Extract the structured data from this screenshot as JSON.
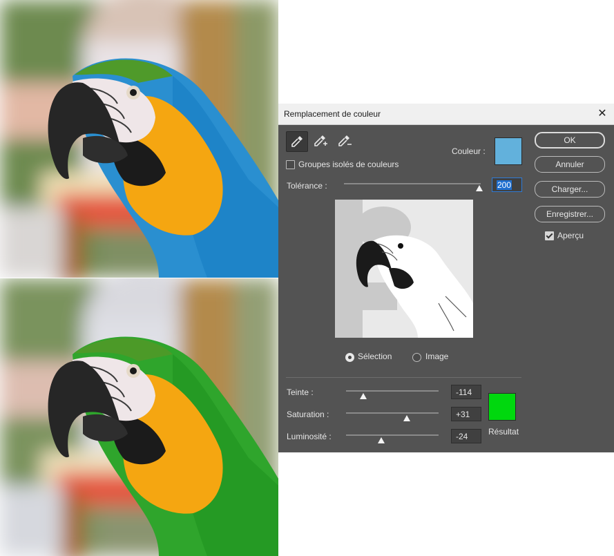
{
  "dialog": {
    "title": "Remplacement de couleur",
    "tools": [
      {
        "icon": "eyedropper-icon",
        "active": true
      },
      {
        "icon": "eyedropper-plus-icon",
        "active": false
      },
      {
        "icon": "eyedropper-minus-icon",
        "active": false
      }
    ],
    "localized_color_clusters_label": "Groupes isolés de couleurs",
    "localized_color_clusters_checked": false,
    "color_label": "Couleur :",
    "color_swatch": "#62b1dc",
    "fuzziness_label": "Tolérance :",
    "fuzziness_value": "200",
    "radio_selection_label": "Sélection",
    "radio_image_label": "Image",
    "selected_view": "Sélection",
    "hue_label": "Teinte :",
    "hue_value": "-114",
    "saturation_label": "Saturation :",
    "saturation_value": "+31",
    "lightness_label": "Luminosité :",
    "lightness_value": "-24",
    "result_label": "Résultat",
    "result_swatch": "#00d80e",
    "buttons": {
      "ok": "OK",
      "cancel": "Annuler",
      "load": "Charger...",
      "save": "Enregistrer..."
    },
    "preview_label": "Aperçu",
    "preview_checked": true
  },
  "colors": {
    "dialog_bg": "#535353",
    "titlebar_bg": "#f0f0f0",
    "focus_blue": "#1f6fd0",
    "parrot_original_body": "#2a8fd0",
    "parrot_replaced_body": "#2fa52c",
    "parrot_chest": "#f5a611"
  }
}
